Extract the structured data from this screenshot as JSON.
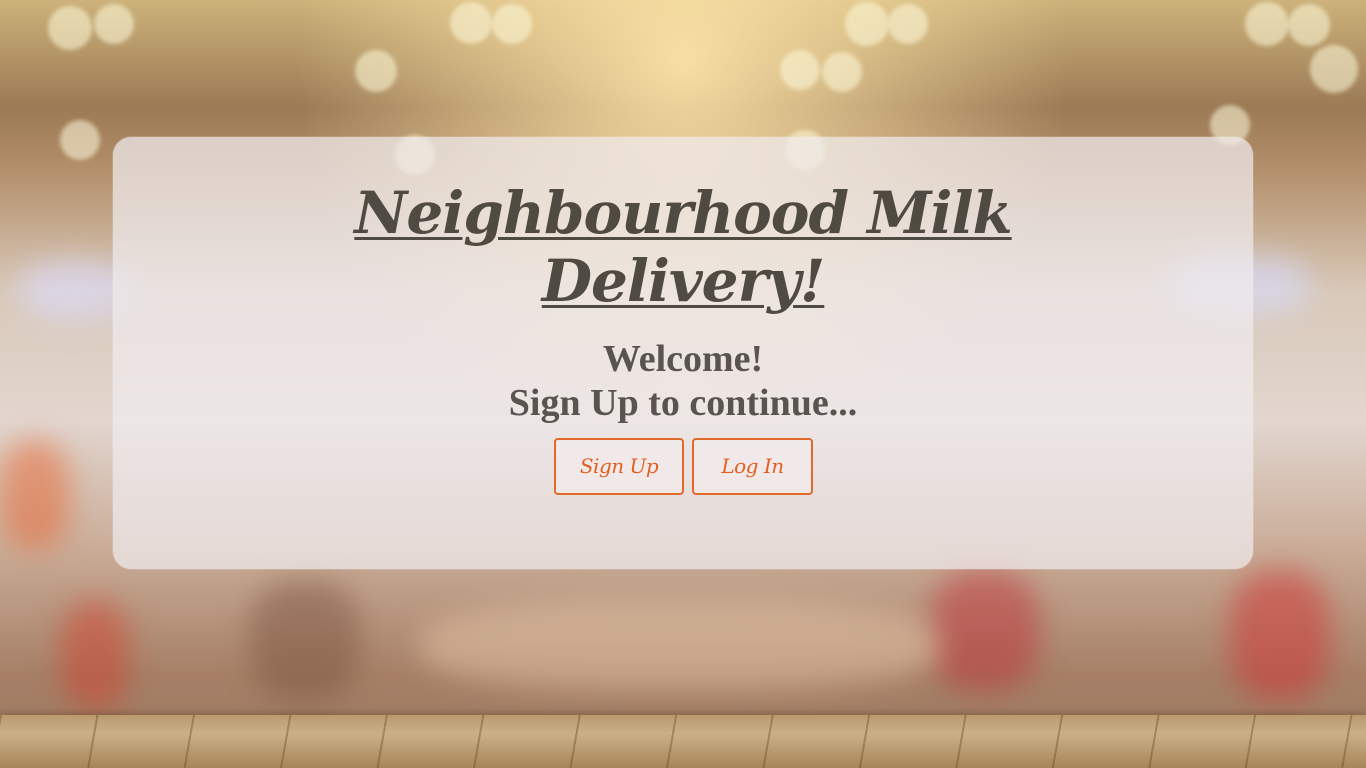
{
  "hero": {
    "title_line1": "Neighbourhood Milk",
    "title_line2": "Delivery!",
    "welcome_line1": "Welcome!",
    "welcome_line2": "Sign Up to continue..."
  },
  "actions": {
    "signup_label": "Sign Up",
    "login_label": "Log In"
  },
  "colors": {
    "accent": "#e2601e",
    "title": "#4f4a42",
    "text": "#5a5450",
    "card": "rgba(240,236,238,0.72)"
  }
}
